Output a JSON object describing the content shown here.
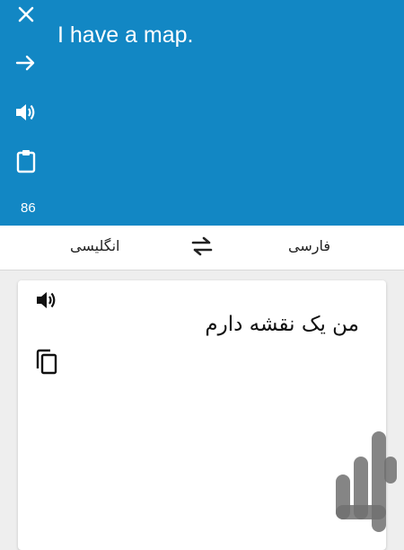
{
  "input": {
    "text": "I have a map.",
    "char_count": "86"
  },
  "toolbar": {
    "close_icon": "close-icon",
    "translate_icon": "arrow-right-icon",
    "speak_icon": "volume-icon",
    "paste_icon": "clipboard-icon"
  },
  "languages": {
    "source": "فارسی",
    "target": "انگلیسی"
  },
  "result": {
    "text": "من یک نقشه دارم"
  },
  "colors": {
    "primary": "#1287c4",
    "background": "#eeeeee",
    "card": "#ffffff"
  }
}
